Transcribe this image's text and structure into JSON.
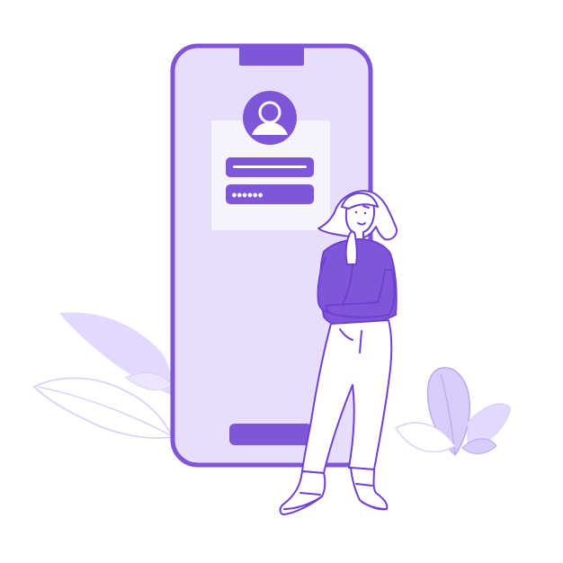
{
  "palette": {
    "primary": "#7f56d9",
    "light": "#e7defe",
    "card": "#f3f2f2",
    "leaf": "#d7cdfb",
    "skin": "#ffffff",
    "outline": "#7041d0"
  },
  "login_form": {
    "avatar_icon": "user-avatar-icon",
    "username_value": "",
    "password_value": "●●●●●●"
  },
  "phone": {
    "notch": "notch",
    "home_bar": "home-indicator"
  }
}
